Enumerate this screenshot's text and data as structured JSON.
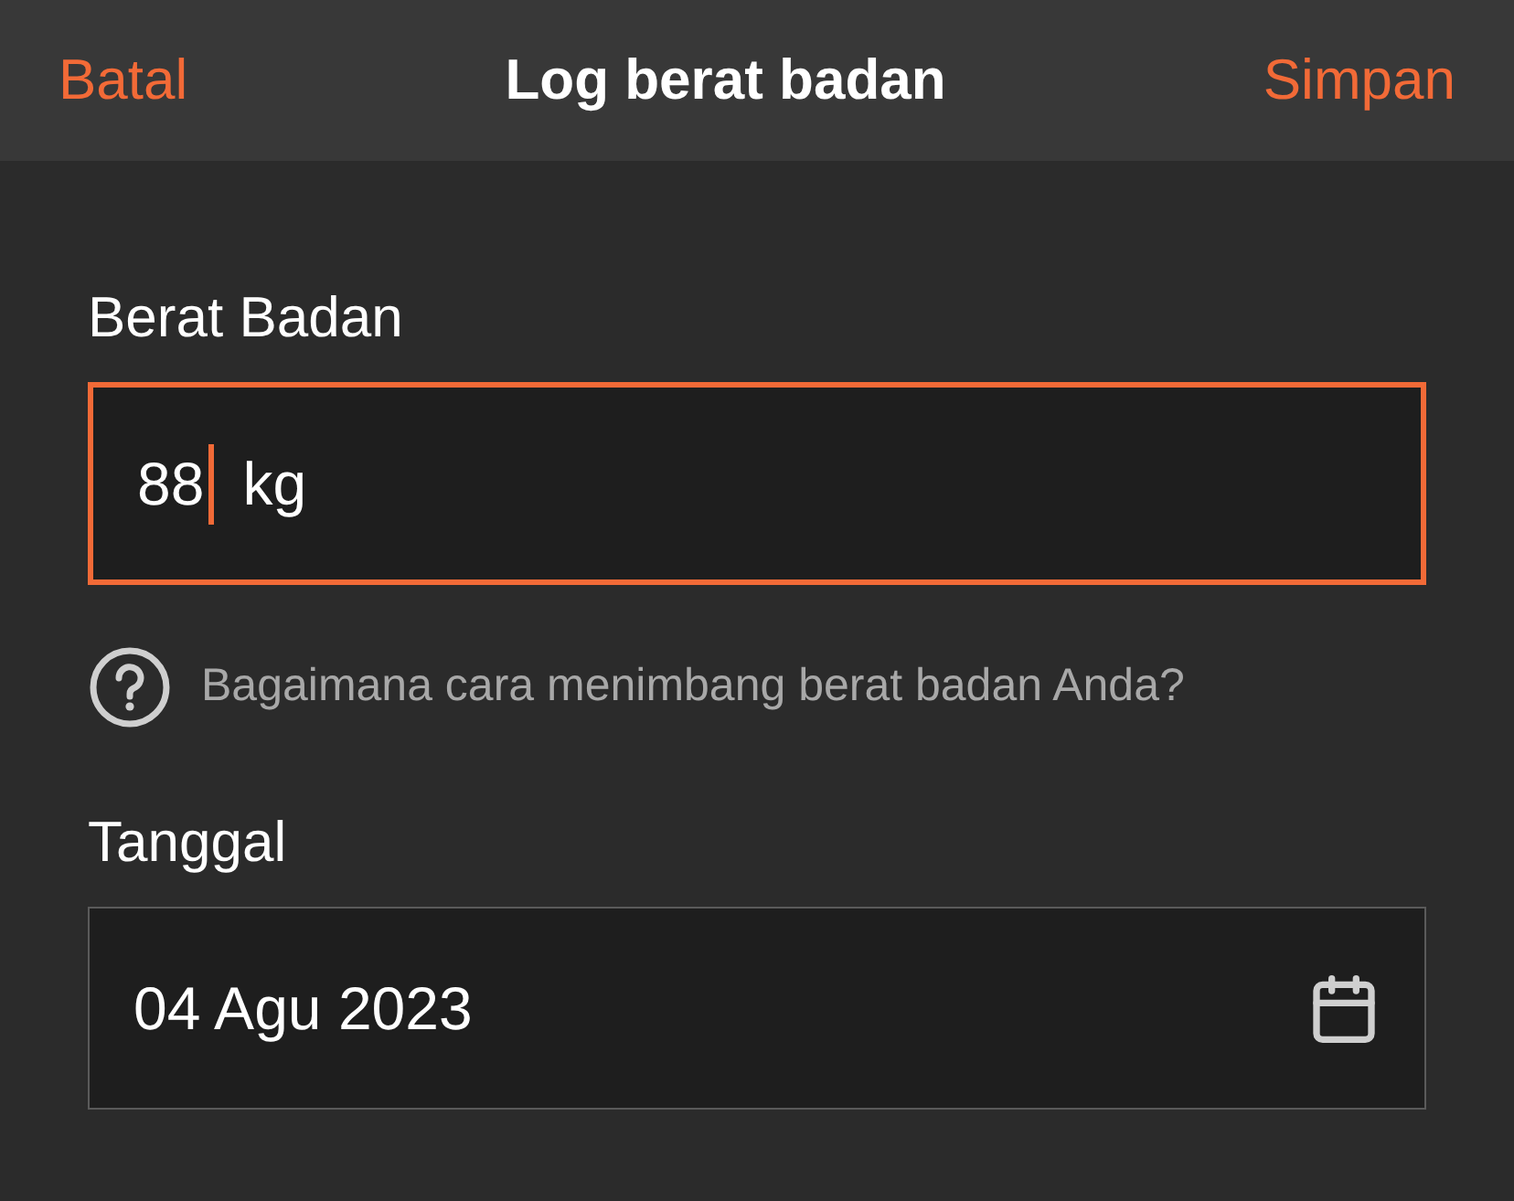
{
  "header": {
    "cancel": "Batal",
    "title": "Log berat badan",
    "save": "Simpan"
  },
  "weight": {
    "label": "Berat Badan",
    "value": "88",
    "unit": "kg",
    "focused": true
  },
  "help": {
    "text": "Bagaimana cara menimbang berat badan Anda?"
  },
  "date": {
    "label": "Tanggal",
    "value": "04 Agu 2023",
    "focused": false
  }
}
